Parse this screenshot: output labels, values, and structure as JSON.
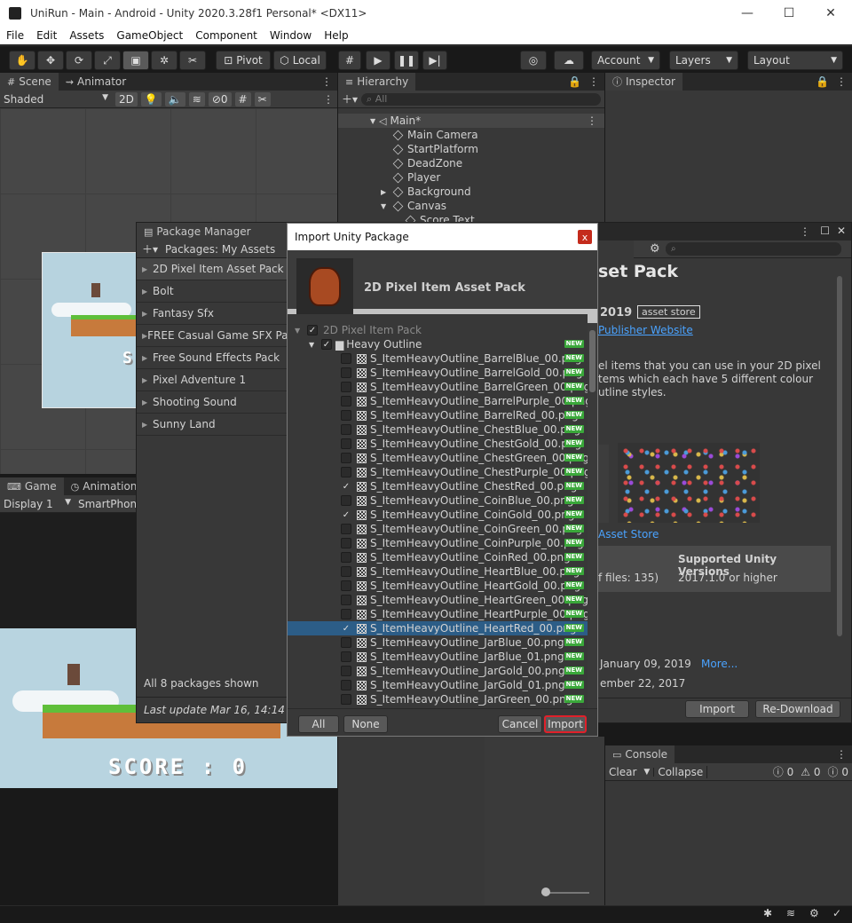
{
  "window": {
    "title": "UniRun - Main - Android - Unity 2020.3.28f1 Personal* <DX11>",
    "minimize": "—",
    "maximize": "☐",
    "close": "✕"
  },
  "menu": [
    "File",
    "Edit",
    "Assets",
    "GameObject",
    "Component",
    "Window",
    "Help"
  ],
  "toolbar": {
    "pivot": "Pivot",
    "local": "Local",
    "account": "Account",
    "layers": "Layers",
    "layout": "Layout"
  },
  "scene": {
    "tab_scene": "Scene",
    "tab_animator": "Animator",
    "shading": "Shaded",
    "mode_2d": "2D",
    "hidden_count": "0",
    "score_fragment": "S"
  },
  "game": {
    "tab_game": "Game",
    "tab_animation": "Animation",
    "display": "Display 1",
    "resolution": "SmartPhone",
    "score": "SCORE : 0"
  },
  "hierarchy": {
    "tab": "Hierarchy",
    "search_placeholder": "All",
    "scene": "Main*",
    "items": [
      "Main Camera",
      "StartPlatform",
      "DeadZone",
      "Player",
      "Background",
      "Canvas",
      "Score Text"
    ]
  },
  "inspector": {
    "tab": "Inspector"
  },
  "package_manager": {
    "title": "Package Manager",
    "filter": "Packages: My Assets",
    "packages": [
      "2D Pixel Item Asset Pack",
      "Bolt",
      "Fantasy Sfx",
      "FREE Casual Game SFX Pack",
      "Free Sound Effects Pack",
      "Pixel Adventure 1",
      "Shooting Sound",
      "Sunny Land"
    ],
    "footer_count": "All 8 packages shown",
    "last_update": "Last update Mar 16, 14:14",
    "details": {
      "title_fragment": "set Pack",
      "year_fragment": "2019",
      "badge": "asset store",
      "publisher_link": "Publisher Website",
      "desc_1": "el items that you can use in your 2D pixel",
      "desc_2": "tems which each have 5 different colour",
      "desc_3": "utline styles.",
      "asset_store_link": "Asset Store",
      "supported_header": "Supported Unity Versions",
      "files_fragment": "f files: 135)",
      "supported_value": "2017.1.0 or higher",
      "date_1": "January 09, 2019",
      "more": "More...",
      "date_2": "ember 22, 2017",
      "import_btn": "Import",
      "redownload_btn": "Re-Download"
    }
  },
  "import_dialog": {
    "title": "Import Unity Package",
    "close": "x",
    "package_name": "2D Pixel Item Asset Pack",
    "root": "2D Pixel Item Pack",
    "folder": "Heavy Outline",
    "new_badge": "NEW",
    "files": [
      {
        "name": "S_ItemHeavyOutline_BarrelBlue_00.png",
        "checked": false
      },
      {
        "name": "S_ItemHeavyOutline_BarrelGold_00.png",
        "checked": false
      },
      {
        "name": "S_ItemHeavyOutline_BarrelGreen_00.png",
        "checked": false
      },
      {
        "name": "S_ItemHeavyOutline_BarrelPurple_00.png",
        "checked": false
      },
      {
        "name": "S_ItemHeavyOutline_BarrelRed_00.png",
        "checked": false
      },
      {
        "name": "S_ItemHeavyOutline_ChestBlue_00.png",
        "checked": false
      },
      {
        "name": "S_ItemHeavyOutline_ChestGold_00.png",
        "checked": false
      },
      {
        "name": "S_ItemHeavyOutline_ChestGreen_00.png",
        "checked": false
      },
      {
        "name": "S_ItemHeavyOutline_ChestPurple_00.png",
        "checked": false
      },
      {
        "name": "S_ItemHeavyOutline_ChestRed_00.png",
        "checked": true
      },
      {
        "name": "S_ItemHeavyOutline_CoinBlue_00.png",
        "checked": false
      },
      {
        "name": "S_ItemHeavyOutline_CoinGold_00.png",
        "checked": true
      },
      {
        "name": "S_ItemHeavyOutline_CoinGreen_00.png",
        "checked": false
      },
      {
        "name": "S_ItemHeavyOutline_CoinPurple_00.png",
        "checked": false
      },
      {
        "name": "S_ItemHeavyOutline_CoinRed_00.png",
        "checked": false
      },
      {
        "name": "S_ItemHeavyOutline_HeartBlue_00.png",
        "checked": false
      },
      {
        "name": "S_ItemHeavyOutline_HeartGold_00.png",
        "checked": false
      },
      {
        "name": "S_ItemHeavyOutline_HeartGreen_00.png",
        "checked": false
      },
      {
        "name": "S_ItemHeavyOutline_HeartPurple_00.png",
        "checked": false
      },
      {
        "name": "S_ItemHeavyOutline_HeartRed_00.png",
        "checked": true,
        "selected": true
      },
      {
        "name": "S_ItemHeavyOutline_JarBlue_00.png",
        "checked": false
      },
      {
        "name": "S_ItemHeavyOutline_JarBlue_01.png",
        "checked": false
      },
      {
        "name": "S_ItemHeavyOutline_JarGold_00.png",
        "checked": false
      },
      {
        "name": "S_ItemHeavyOutline_JarGold_01.png",
        "checked": false
      },
      {
        "name": "S_ItemHeavyOutline_JarGreen_00.png",
        "checked": false
      }
    ],
    "btn_all": "All",
    "btn_none": "None",
    "btn_cancel": "Cancel",
    "btn_import": "Import"
  },
  "console": {
    "tab": "Console",
    "clear": "Clear",
    "collapse": "Collapse",
    "errors": "0",
    "warnings": "0",
    "messages": "0"
  },
  "colors": {
    "accent_select": "#2c5d87",
    "highlight_red": "#e0202a",
    "new_badge": "#3aa83a",
    "link": "#4aa3ff"
  }
}
